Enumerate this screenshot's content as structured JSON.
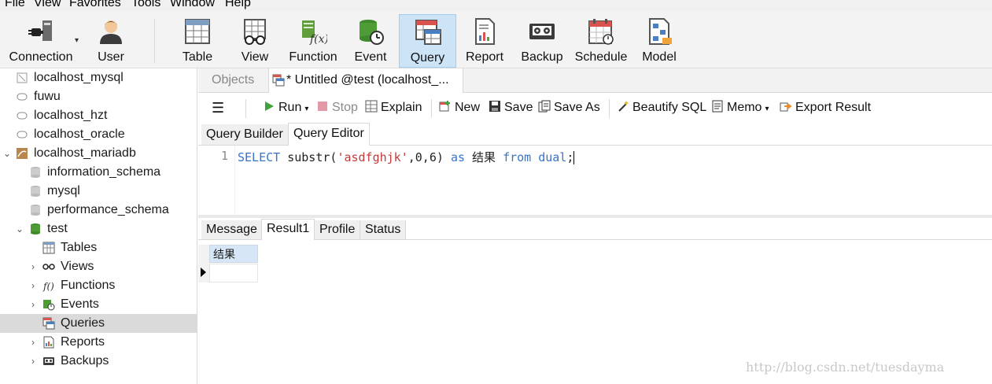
{
  "menu": [
    "File",
    "View",
    "Favorites",
    "Tools",
    "Window",
    "Help"
  ],
  "toolbar": {
    "buttons": [
      {
        "label": "Connection",
        "icon": "connection-icon"
      },
      {
        "label": "User",
        "icon": "user-icon"
      },
      {
        "label": "Table",
        "icon": "table-icon"
      },
      {
        "label": "View",
        "icon": "view-icon"
      },
      {
        "label": "Function",
        "icon": "function-icon"
      },
      {
        "label": "Event",
        "icon": "event-icon"
      },
      {
        "label": "Query",
        "icon": "query-icon",
        "active": true
      },
      {
        "label": "Report",
        "icon": "report-icon"
      },
      {
        "label": "Backup",
        "icon": "backup-icon"
      },
      {
        "label": "Schedule",
        "icon": "schedule-icon"
      },
      {
        "label": "Model",
        "icon": "model-icon"
      }
    ]
  },
  "navigator": {
    "items": [
      {
        "label": "localhost_mysql",
        "icon": "connection-icon"
      },
      {
        "label": "fuwu",
        "icon": "connection-icon"
      },
      {
        "label": "localhost_hzt",
        "icon": "connection-icon"
      },
      {
        "label": "localhost_oracle",
        "icon": "connection-icon"
      },
      {
        "label": "localhost_mariadb",
        "icon": "mariadb-connection-icon",
        "expanded": true
      },
      {
        "label": "information_schema",
        "icon": "database-icon"
      },
      {
        "label": "mysql",
        "icon": "database-icon"
      },
      {
        "label": "performance_schema",
        "icon": "database-icon"
      },
      {
        "label": "test",
        "icon": "database-icon",
        "expanded": true
      },
      {
        "label": "Tables",
        "icon": "table-icon"
      },
      {
        "label": "Views",
        "icon": "view-icon"
      },
      {
        "label": "Functions",
        "icon": "function-icon"
      },
      {
        "label": "Events",
        "icon": "event-icon"
      },
      {
        "label": "Queries",
        "icon": "query-icon",
        "selected": true
      },
      {
        "label": "Reports",
        "icon": "report-icon"
      },
      {
        "label": "Backups",
        "icon": "backup-icon"
      }
    ]
  },
  "tabs": {
    "objects": "Objects",
    "query_tab": "* Untitled @test (localhost_..."
  },
  "query_toolbar": {
    "menu": "menu-icon",
    "run": "Run",
    "stop": "Stop",
    "explain": "Explain",
    "new": "New",
    "save": "Save",
    "save_as": "Save As",
    "beautify": "Beautify SQL",
    "memo": "Memo",
    "export": "Export Result"
  },
  "subtabs": {
    "builder": "Query Builder",
    "editor": "Query Editor"
  },
  "editor": {
    "line_number": "1",
    "tokens": {
      "kw_select": "SELECT",
      "fn": " substr(",
      "str": "'asdfghjk'",
      "args": ",0,6) ",
      "kw_as": "as",
      "alias": " 结果 ",
      "kw_from": "from",
      "sp": " ",
      "kw_dual": "dual",
      "semi": ";"
    }
  },
  "result_tabs": {
    "message": "Message",
    "result1": "Result1",
    "profile": "Profile",
    "status": "Status"
  },
  "grid": {
    "column": "结果",
    "value": ""
  },
  "watermark": "http://blog.csdn.net/tuesdayma",
  "colors": {
    "accent_selected": "#cde4f7",
    "keyword": "#3b73c9",
    "string": "#c23b3b"
  }
}
